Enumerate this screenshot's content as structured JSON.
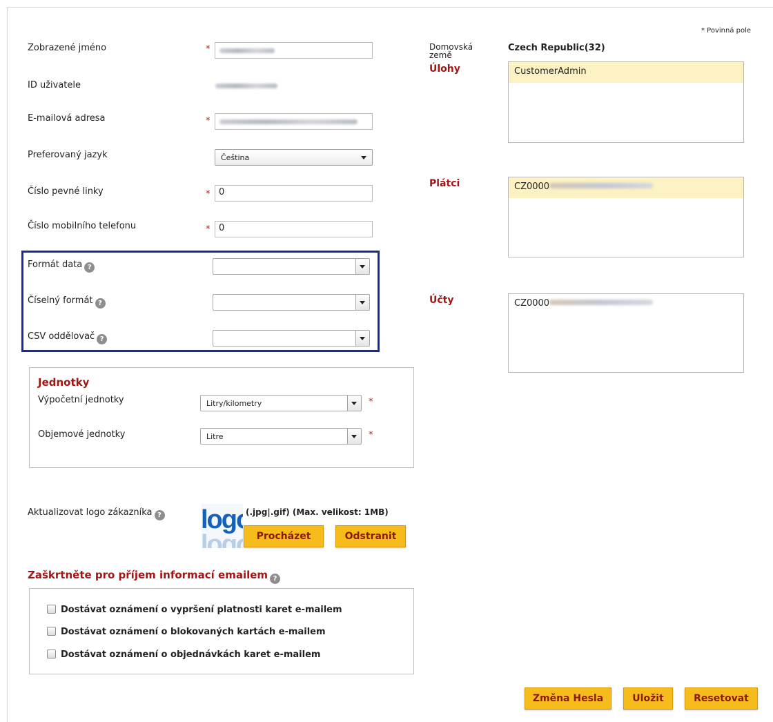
{
  "required_note": "* Povinná pole",
  "required_mark": "*",
  "fields": {
    "display_name": {
      "label": "Zobrazené jméno"
    },
    "user_id": {
      "label": "ID uživatele"
    },
    "email": {
      "label": "E-mailová adresa"
    },
    "language": {
      "label": "Preferovaný jazyk",
      "value": "Čeština"
    },
    "landline": {
      "label": "Číslo pevné linky",
      "value": "0"
    },
    "mobile": {
      "label": "Číslo mobilního telefonu",
      "value": "0"
    },
    "date_format": {
      "label": "Formát data",
      "value": ""
    },
    "number_format": {
      "label": "Číselný formát",
      "value": ""
    },
    "csv_separator": {
      "label": "CSV oddělovač",
      "value": ""
    }
  },
  "units": {
    "heading": "Jednotky",
    "calc_label": "Výpočetní jednotky",
    "calc_value": "Litry/kilometry",
    "volume_label": "Objemové jednotky",
    "volume_value": "Litre"
  },
  "logo": {
    "label": "Aktualizovat logo zákazníka",
    "image_text": "logo",
    "hint": "(.jpg|.gif) (Max. velikost: 1MB)",
    "browse": "Procházet",
    "remove": "Odstranit"
  },
  "email_notifications": {
    "heading": "Zaškrtněte pro příjem informací emailem",
    "options": [
      "Dostávat oznámení o vypršení platnosti karet e-mailem",
      "Dostávat oznámení o blokovaných kartách e-mailem",
      "Dostávat oznámení o objednávkách karet e-mailem"
    ]
  },
  "right": {
    "home_country_label_1": "Domovská",
    "home_country_label_2": "země",
    "home_country_value": "Czech Republic(32)",
    "roles_label": "Úlohy",
    "roles": [
      "CustomerAdmin"
    ],
    "payers_label": "Plátci",
    "payers": [
      "CZ0000"
    ],
    "accounts_label": "Účty",
    "accounts": [
      "CZ0000"
    ]
  },
  "buttons": {
    "change_password": "Změna Hesla",
    "save": "Uložit",
    "reset": "Resetovat"
  },
  "icons": {
    "help": "?"
  },
  "colors": {
    "accent_red": "#a31515",
    "button_yellow": "#f5bc1c",
    "highlight_border": "#1a2a9c"
  }
}
